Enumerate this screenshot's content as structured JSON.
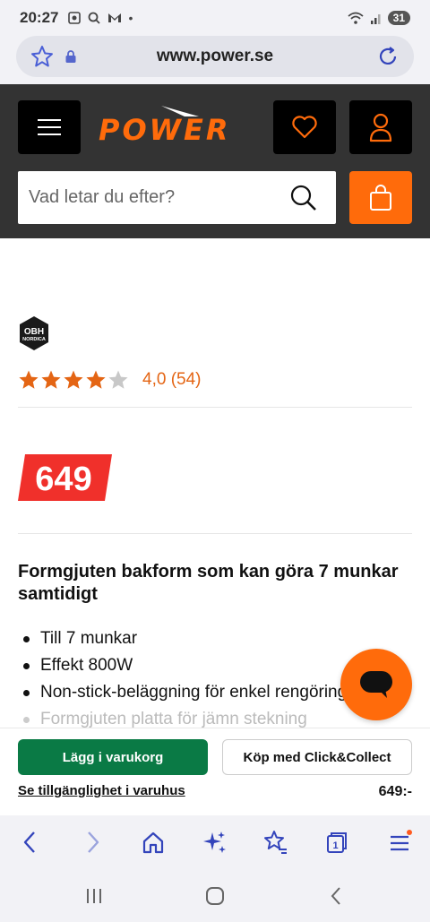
{
  "status_bar": {
    "time": "20:27",
    "battery": "31"
  },
  "browser": {
    "url": "www.power.se"
  },
  "header": {
    "logo_text": "POWER",
    "search": {
      "placeholder": "Vad letar du efter?"
    }
  },
  "product": {
    "brand_line1": "OBH",
    "brand_line2": "NORDICA",
    "rating": {
      "value": 4.0,
      "max": 5,
      "text": "4,0 (54)"
    },
    "price": "649",
    "title": "Formgjuten bakform som kan göra 7 munkar samtidigt",
    "features": [
      "Till 7 munkar",
      "Effekt 800W",
      "Non-stick-beläggning för enkel rengöring",
      "Formgjuten platta för jämn stekning"
    ]
  },
  "buy_bar": {
    "add_to_cart": "Lägg i varukorg",
    "click_collect": "Köp med Click&Collect",
    "availability": "Se tillgänglighet i varuhus",
    "price": "649:-"
  },
  "colors": {
    "brand_orange": "#ff6b0b",
    "header_dark": "#333333",
    "price_red": "#f0302b",
    "cart_green": "#0a7a45"
  },
  "browser_nav": {
    "tabs_count": "1"
  }
}
